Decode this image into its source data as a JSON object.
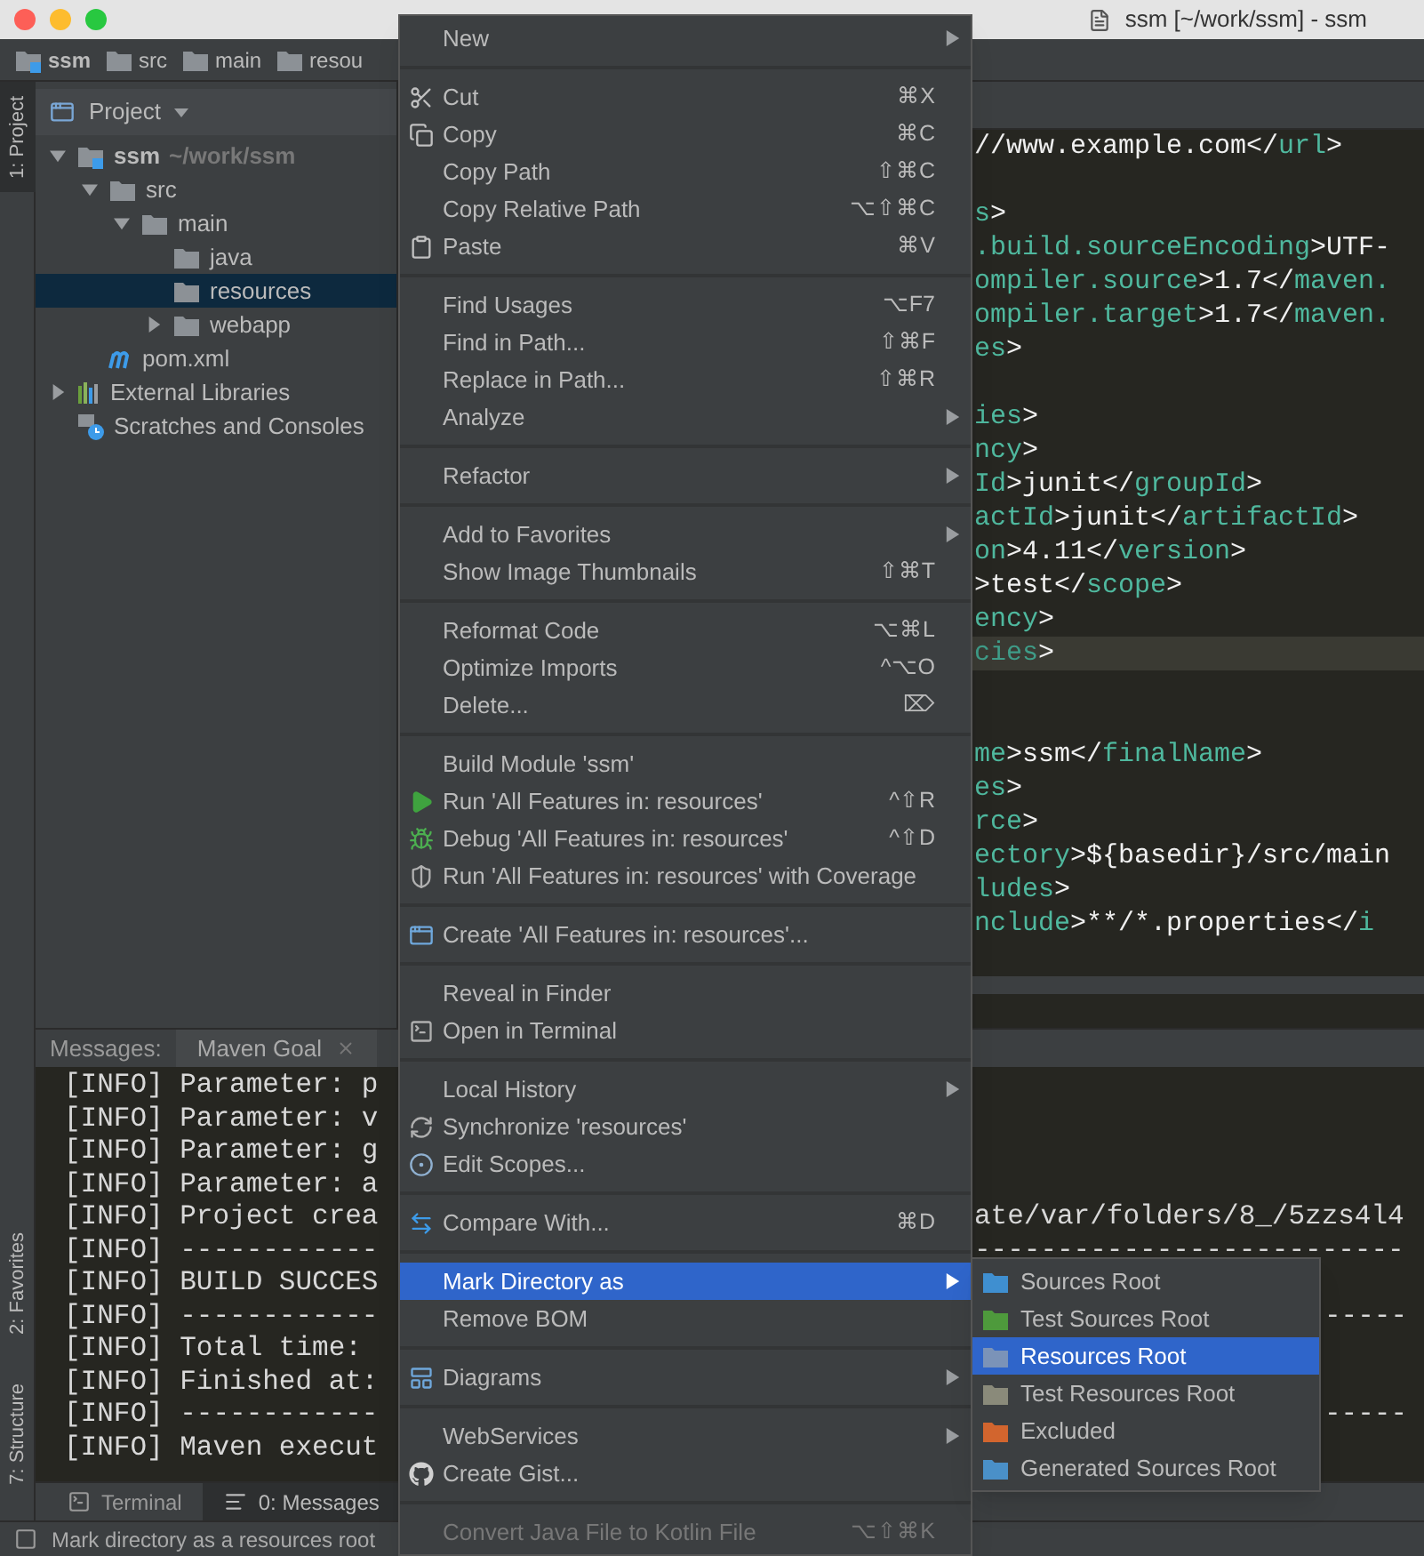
{
  "window": {
    "title": "ssm [~/work/ssm] - ssm"
  },
  "breadcrumbs": [
    {
      "label": "ssm",
      "kind": "module"
    },
    {
      "label": "src",
      "kind": "folder"
    },
    {
      "label": "main",
      "kind": "folder"
    },
    {
      "label": "resou",
      "kind": "folder"
    }
  ],
  "side_stripe": [
    {
      "label": "1: Project",
      "selected": true
    },
    {
      "label": "2: Favorites",
      "selected": false
    },
    {
      "label": "7: Structure",
      "selected": false
    }
  ],
  "project": {
    "title": "Project",
    "tree": [
      {
        "label": "ssm",
        "detail": "~/work/ssm",
        "kind": "module",
        "expanded": true,
        "selected": false,
        "children": [
          {
            "label": "src",
            "kind": "folder",
            "expanded": true,
            "selected": false,
            "children": [
              {
                "label": "main",
                "kind": "folder",
                "expanded": true,
                "selected": false,
                "children": [
                  {
                    "label": "java",
                    "kind": "folder",
                    "selected": false
                  },
                  {
                    "label": "resources",
                    "kind": "folder",
                    "selected": true
                  },
                  {
                    "label": "webapp",
                    "kind": "folder",
                    "expanded": false,
                    "selected": false
                  }
                ]
              }
            ]
          },
          {
            "label": "pom.xml",
            "kind": "maven",
            "selected": false
          }
        ]
      },
      {
        "label": "External Libraries",
        "kind": "libraries",
        "expanded": false,
        "selected": false
      },
      {
        "label": "Scratches and Consoles",
        "kind": "scratches",
        "selected": false
      }
    ]
  },
  "editor": {
    "lines": [
      {
        "current": false,
        "segments": [
          {
            "kind": "text",
            "text": "//www.example.com</"
          },
          {
            "kind": "tag",
            "text": "url"
          },
          {
            "kind": "text",
            "text": ">"
          }
        ]
      },
      {
        "current": false
      },
      {
        "current": false,
        "segments": [
          {
            "kind": "tag",
            "text": "s"
          },
          {
            "kind": "text",
            "text": ">"
          }
        ]
      },
      {
        "current": false,
        "segments": [
          {
            "kind": "tag",
            "text": ".build.sourceEncoding"
          },
          {
            "kind": "text",
            "text": ">UTF-"
          }
        ]
      },
      {
        "current": false,
        "segments": [
          {
            "kind": "tag",
            "text": "ompiler.source"
          },
          {
            "kind": "text",
            "text": ">1.7</"
          },
          {
            "kind": "tag",
            "text": "maven."
          }
        ]
      },
      {
        "current": false,
        "segments": [
          {
            "kind": "tag",
            "text": "ompiler.target"
          },
          {
            "kind": "text",
            "text": ">1.7</"
          },
          {
            "kind": "tag",
            "text": "maven."
          }
        ]
      },
      {
        "current": false,
        "segments": [
          {
            "kind": "tag",
            "text": "es"
          },
          {
            "kind": "text",
            "text": ">"
          }
        ]
      },
      {
        "current": false
      },
      {
        "current": false,
        "segments": [
          {
            "kind": "tag",
            "text": "ies"
          },
          {
            "kind": "text",
            "text": ">"
          }
        ]
      },
      {
        "current": false,
        "segments": [
          {
            "kind": "tag",
            "text": "ncy"
          },
          {
            "kind": "text",
            "text": ">"
          }
        ]
      },
      {
        "current": false,
        "segments": [
          {
            "kind": "tag",
            "text": "Id"
          },
          {
            "kind": "text",
            "text": ">junit</"
          },
          {
            "kind": "tag",
            "text": "groupId"
          },
          {
            "kind": "text",
            "text": ">"
          }
        ]
      },
      {
        "current": false,
        "segments": [
          {
            "kind": "tag",
            "text": "actId"
          },
          {
            "kind": "text",
            "text": ">junit</"
          },
          {
            "kind": "tag",
            "text": "artifactId"
          },
          {
            "kind": "text",
            "text": ">"
          }
        ]
      },
      {
        "current": false,
        "segments": [
          {
            "kind": "tag",
            "text": "on"
          },
          {
            "kind": "text",
            "text": ">4.11</"
          },
          {
            "kind": "tag",
            "text": "version"
          },
          {
            "kind": "text",
            "text": ">"
          }
        ]
      },
      {
        "current": false,
        "segments": [
          {
            "kind": "text",
            "text": ">test</"
          },
          {
            "kind": "tag",
            "text": "scope"
          },
          {
            "kind": "text",
            "text": ">"
          }
        ]
      },
      {
        "current": false,
        "segments": [
          {
            "kind": "tag",
            "text": "ency"
          },
          {
            "kind": "text",
            "text": ">"
          }
        ]
      },
      {
        "current": true,
        "segments": [
          {
            "kind": "tag",
            "text": "cies"
          },
          {
            "kind": "text",
            "text": ">"
          }
        ]
      },
      {
        "current": false
      },
      {
        "current": false
      },
      {
        "current": false,
        "segments": [
          {
            "kind": "tag",
            "text": "me"
          },
          {
            "kind": "text",
            "text": ">ssm</"
          },
          {
            "kind": "tag",
            "text": "finalName"
          },
          {
            "kind": "text",
            "text": ">"
          }
        ]
      },
      {
        "current": false,
        "segments": [
          {
            "kind": "tag",
            "text": "es"
          },
          {
            "kind": "text",
            "text": ">"
          }
        ]
      },
      {
        "current": false,
        "segments": [
          {
            "kind": "tag",
            "text": "rce"
          },
          {
            "kind": "text",
            "text": ">"
          }
        ]
      },
      {
        "current": false,
        "segments": [
          {
            "kind": "tag",
            "text": "ectory"
          },
          {
            "kind": "text",
            "text": ">${basedir}/src/main"
          }
        ]
      },
      {
        "current": false,
        "segments": [
          {
            "kind": "tag",
            "text": "ludes"
          },
          {
            "kind": "text",
            "text": ">"
          }
        ]
      },
      {
        "current": false,
        "segments": [
          {
            "kind": "tag",
            "text": "nclude"
          },
          {
            "kind": "text",
            "text": ">**/*.properties</"
          },
          {
            "kind": "tag",
            "text": "i"
          }
        ]
      }
    ]
  },
  "messages": {
    "label": "Messages:",
    "tab": "Maven Goal",
    "lines": [
      {
        "text": "[INFO] Parameter: p"
      },
      {
        "text": "[INFO] Parameter: v"
      },
      {
        "text": "[INFO] Parameter: g"
      },
      {
        "text": "[INFO] Parameter: a"
      },
      {
        "text": "[INFO] Project crea",
        "right": "ate/var/folders/8_/5zzs4l4"
      },
      {
        "text": "[INFO] ------------",
        "right": "--------------------------"
      },
      {
        "text": "[INFO] BUILD SUCCES"
      },
      {
        "text": "[INFO] ------------",
        "far": "-----"
      },
      {
        "text": "[INFO] Total time:"
      },
      {
        "text": "[INFO] Finished at:"
      },
      {
        "text": "[INFO] ------------",
        "far": "-----"
      },
      {
        "text": "[INFO] Maven execut"
      }
    ]
  },
  "bottom_tabs": [
    {
      "label": "Terminal",
      "selected": false
    },
    {
      "label": "0: Messages",
      "selected": true
    }
  ],
  "status_bar": "Mark directory as a resources root",
  "context_menu": [
    [
      {
        "label": "New",
        "submenu": true
      }
    ],
    [
      {
        "label": "Cut",
        "shortcut": "⌘X"
      },
      {
        "label": "Copy",
        "shortcut": "⌘C"
      },
      {
        "label": "Copy Path",
        "shortcut": "⇧⌘C"
      },
      {
        "label": "Copy Relative Path",
        "shortcut": "⌥⇧⌘C"
      },
      {
        "label": "Paste",
        "shortcut": "⌘V"
      }
    ],
    [
      {
        "label": "Find Usages",
        "shortcut": "⌥F7"
      },
      {
        "label": "Find in Path...",
        "shortcut": "⇧⌘F"
      },
      {
        "label": "Replace in Path...",
        "shortcut": "⇧⌘R"
      },
      {
        "label": "Analyze",
        "submenu": true
      }
    ],
    [
      {
        "label": "Refactor",
        "submenu": true
      }
    ],
    [
      {
        "label": "Add to Favorites",
        "submenu": true
      },
      {
        "label": "Show Image Thumbnails",
        "shortcut": "⇧⌘T"
      }
    ],
    [
      {
        "label": "Reformat Code",
        "shortcut": "⌥⌘L"
      },
      {
        "label": "Optimize Imports",
        "shortcut": "^⌥O"
      },
      {
        "label": "Delete...",
        "shortcut": "⌦"
      }
    ],
    [
      {
        "label": "Build Module 'ssm'"
      },
      {
        "label": "Run 'All Features in: resources'",
        "shortcut": "^⇧R"
      },
      {
        "label": "Debug 'All Features in: resources'",
        "shortcut": "^⇧D"
      },
      {
        "label": "Run 'All Features in: resources' with Coverage"
      }
    ],
    [
      {
        "label": "Create 'All Features in: resources'..."
      }
    ],
    [
      {
        "label": "Reveal in Finder"
      },
      {
        "label": "Open in Terminal"
      }
    ],
    [
      {
        "label": "Local History",
        "submenu": true
      },
      {
        "label": "Synchronize 'resources'"
      },
      {
        "label": "Edit Scopes..."
      }
    ],
    [
      {
        "label": "Compare With...",
        "shortcut": "⌘D"
      }
    ],
    [
      {
        "label": "Mark Directory as",
        "submenu": true,
        "selected": true
      },
      {
        "label": "Remove BOM"
      }
    ],
    [
      {
        "label": "Diagrams",
        "submenu": true
      }
    ],
    [
      {
        "label": "WebServices",
        "submenu": true
      },
      {
        "label": "Create Gist..."
      }
    ],
    [
      {
        "label": "Convert Java File to Kotlin File",
        "shortcut": "⌥⇧⌘K",
        "disabled": true
      }
    ]
  ],
  "submenu": [
    {
      "label": "Sources Root",
      "color": "#3f8fd0",
      "selected": false
    },
    {
      "label": "Test Sources Root",
      "color": "#4e9a3c",
      "selected": false
    },
    {
      "label": "Resources Root",
      "color": "#7b93b8",
      "selected": true
    },
    {
      "label": "Test Resources Root",
      "color": "#8a8a7a",
      "selected": false
    },
    {
      "label": "Excluded",
      "color": "#d2652e",
      "selected": false
    },
    {
      "label": "Generated Sources Root",
      "color": "#4a90c8",
      "selected": false
    }
  ]
}
